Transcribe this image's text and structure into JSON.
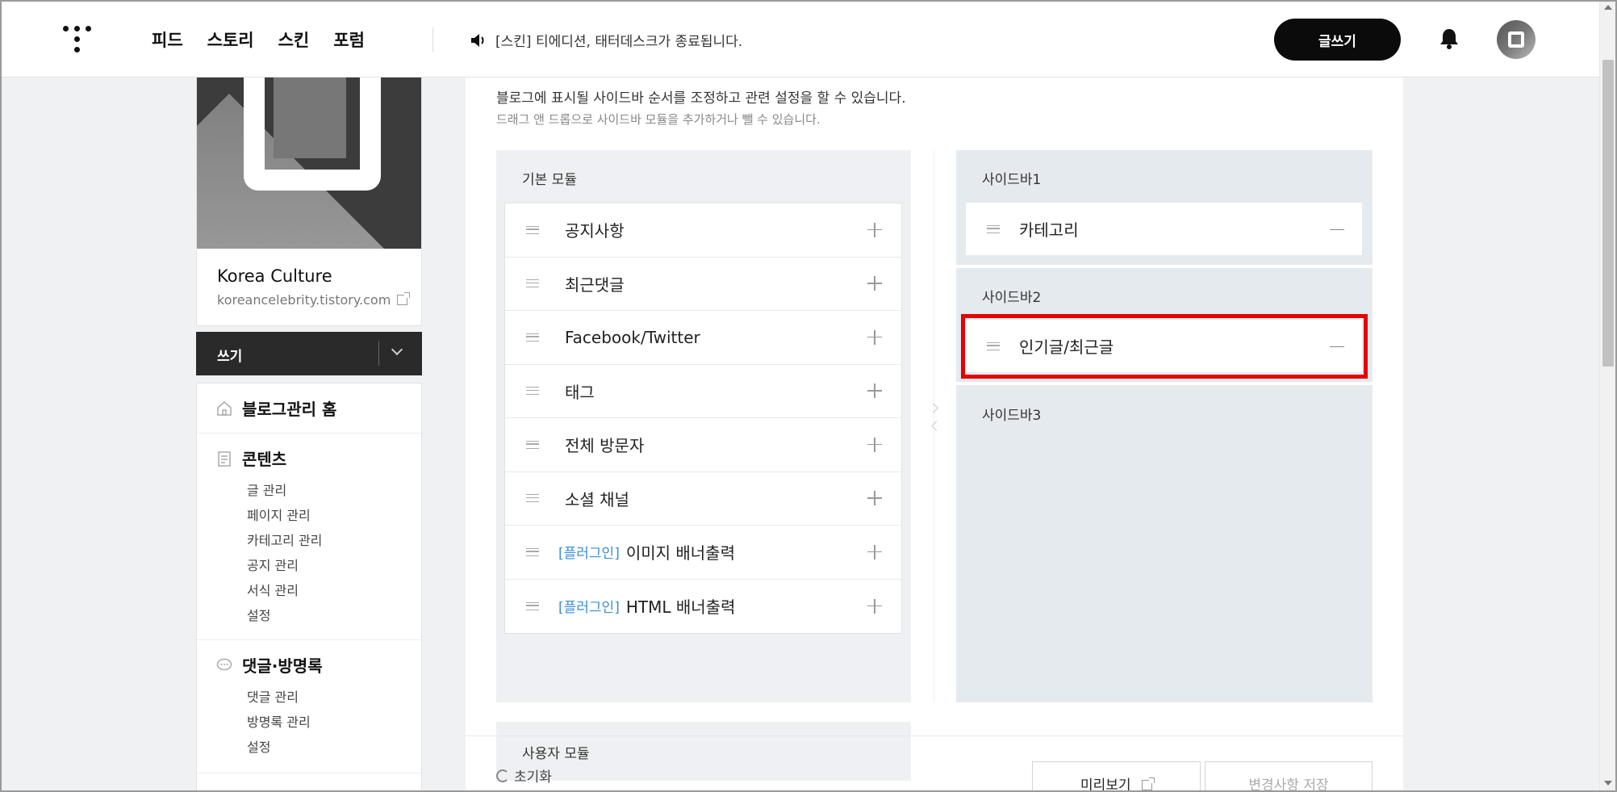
{
  "header": {
    "nav": [
      "피드",
      "스토리",
      "스킨",
      "포럼"
    ],
    "notice": "[스킨] 티에디션, 태터데스크가 종료됩니다.",
    "write_button": "글쓰기"
  },
  "blog": {
    "name": "Korea Culture",
    "url": "koreancelebrity.tistory.com"
  },
  "write_bar": {
    "label": "쓰기"
  },
  "menu": {
    "home": "블로그관리 홈",
    "contents": {
      "title": "콘텐츠",
      "items": [
        "글 관리",
        "페이지 관리",
        "카테고리 관리",
        "공지 관리",
        "서식 관리",
        "설정"
      ]
    },
    "comments": {
      "title": "댓글·방명록",
      "items": [
        "댓글 관리",
        "방명록 관리",
        "설정"
      ]
    }
  },
  "main": {
    "desc1": "블로그에 표시될 사이드바 순서를 조정하고 관련 설정을 할 수 있습니다.",
    "desc2": "드래그 앤 드롭으로 사이드바 모듈을 추가하거나 뺄 수 있습니다.",
    "basic_title": "기본 모듈",
    "modules": [
      {
        "tag": "",
        "label": "공지사항"
      },
      {
        "tag": "",
        "label": "최근댓글"
      },
      {
        "tag": "",
        "label": "Facebook/Twitter"
      },
      {
        "tag": "",
        "label": "태그"
      },
      {
        "tag": "",
        "label": "전체 방문자"
      },
      {
        "tag": "",
        "label": "소셜 채널"
      },
      {
        "tag": "[플러그인]",
        "label": "이미지 배너출력"
      },
      {
        "tag": "[플러그인]",
        "label": "HTML 배너출력"
      }
    ],
    "user_title": "사용자 모듈",
    "sidebar1": {
      "title": "사이드바1",
      "items": [
        "카테고리"
      ]
    },
    "sidebar2": {
      "title": "사이드바2",
      "items": [
        "인기글/최근글"
      ]
    },
    "sidebar3": {
      "title": "사이드바3"
    },
    "footer": {
      "reset": "초기화",
      "preview": "미리보기",
      "save": "변경사항 저장"
    }
  },
  "colors": {
    "highlight": "#e60000",
    "plugin_tag": "#3b8ed6",
    "write_button": "#0b0b0b"
  }
}
